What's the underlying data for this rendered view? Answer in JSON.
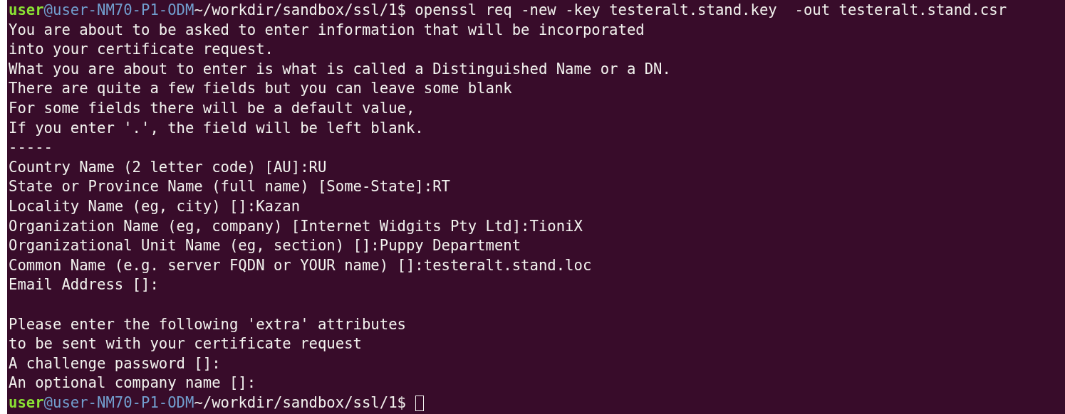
{
  "terminal": {
    "lines": [
      {
        "kind": "prompt",
        "user": "user",
        "host": "@user-NM70-P1-ODM",
        "path": "~/workdir/sandbox/ssl/1$",
        "command": "openssl req -new -key testeralt.stand.key  -out testeralt.stand.csr",
        "cursor": false
      },
      {
        "kind": "output",
        "text": "You are about to be asked to enter information that will be incorporated"
      },
      {
        "kind": "output",
        "text": "into your certificate request."
      },
      {
        "kind": "output",
        "text": "What you are about to enter is what is called a Distinguished Name or a DN."
      },
      {
        "kind": "output",
        "text": "There are quite a few fields but you can leave some blank"
      },
      {
        "kind": "output",
        "text": "For some fields there will be a default value,"
      },
      {
        "kind": "output",
        "text": "If you enter '.', the field will be left blank."
      },
      {
        "kind": "output",
        "text": "-----"
      },
      {
        "kind": "output",
        "text": "Country Name (2 letter code) [AU]:RU"
      },
      {
        "kind": "output",
        "text": "State or Province Name (full name) [Some-State]:RT"
      },
      {
        "kind": "output",
        "text": "Locality Name (eg, city) []:Kazan"
      },
      {
        "kind": "output",
        "text": "Organization Name (eg, company) [Internet Widgits Pty Ltd]:TioniX"
      },
      {
        "kind": "output",
        "text": "Organizational Unit Name (eg, section) []:Puppy Department"
      },
      {
        "kind": "output",
        "text": "Common Name (e.g. server FQDN or YOUR name) []:testeralt.stand.loc"
      },
      {
        "kind": "output",
        "text": "Email Address []:"
      },
      {
        "kind": "blank"
      },
      {
        "kind": "output",
        "text": "Please enter the following 'extra' attributes"
      },
      {
        "kind": "output",
        "text": "to be sent with your certificate request"
      },
      {
        "kind": "output",
        "text": "A challenge password []:"
      },
      {
        "kind": "output",
        "text": "An optional company name []:"
      },
      {
        "kind": "prompt",
        "user": "user",
        "host": "@user-NM70-P1-ODM",
        "path": "~/workdir/sandbox/ssl/1$",
        "cursor": true
      }
    ]
  }
}
